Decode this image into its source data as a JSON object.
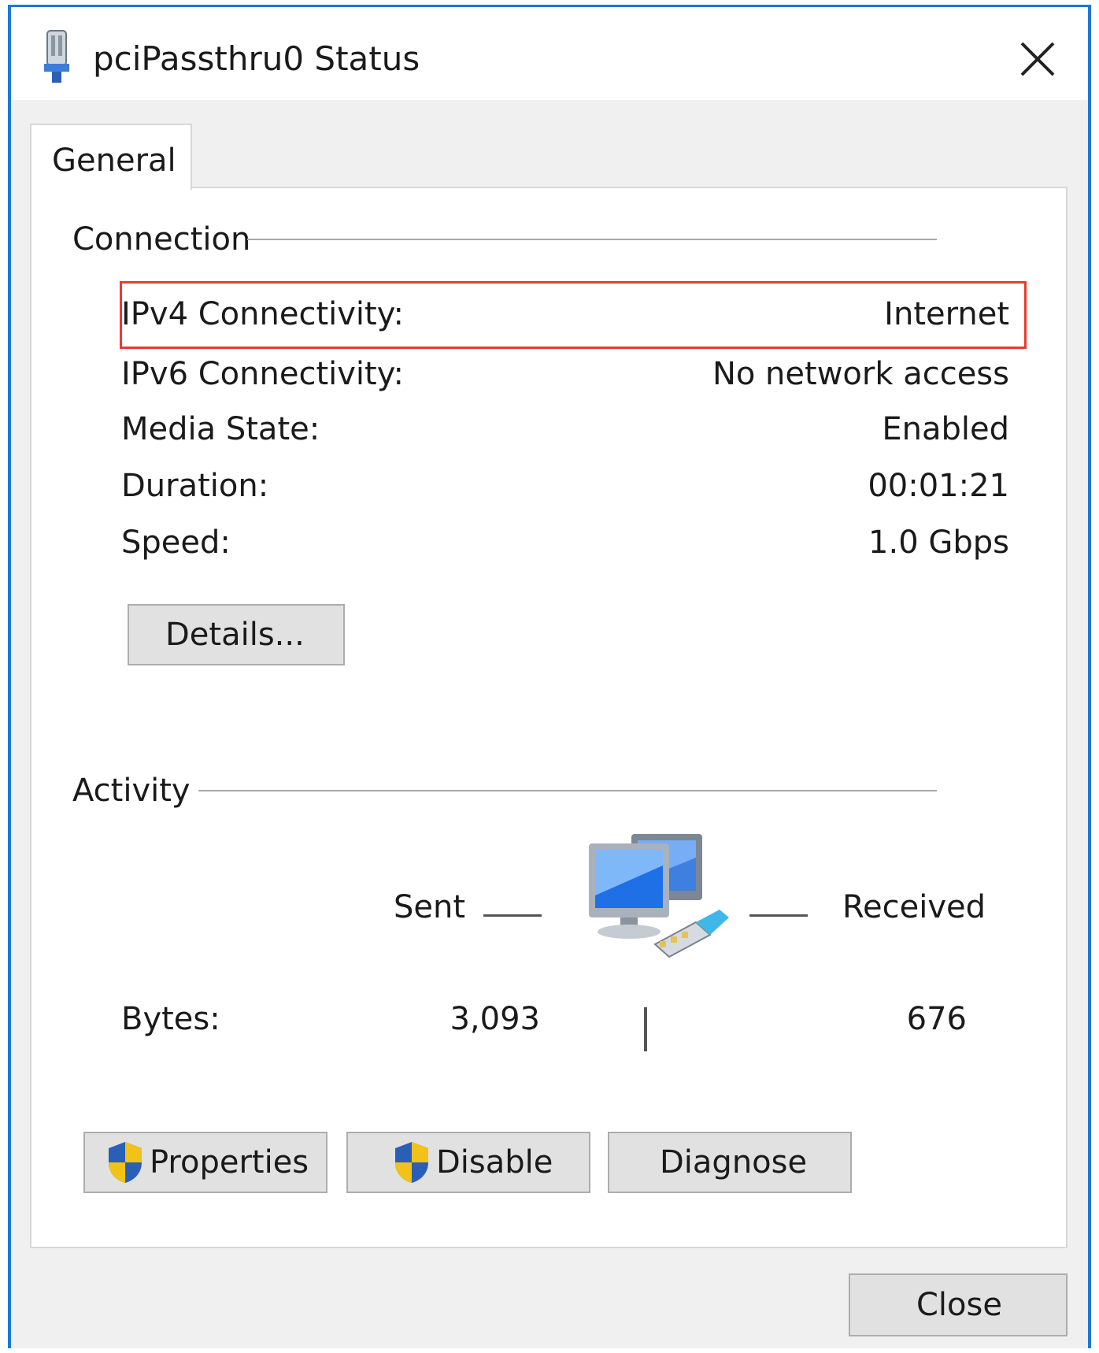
{
  "window": {
    "title": "pciPassthru0 Status",
    "close_glyph": "✕"
  },
  "tabs": [
    {
      "label": "General",
      "selected": true
    }
  ],
  "connection": {
    "group_title": "Connection",
    "rows": [
      {
        "label": "IPv4 Connectivity:",
        "value": "Internet",
        "highlighted": true
      },
      {
        "label": "IPv6 Connectivity:",
        "value": "No network access"
      },
      {
        "label": "Media State:",
        "value": "Enabled"
      },
      {
        "label": "Duration:",
        "value": "00:01:21"
      },
      {
        "label": "Speed:",
        "value": "1.0 Gbps"
      }
    ],
    "details_button": "Details..."
  },
  "activity": {
    "group_title": "Activity",
    "sent_label": "Sent",
    "received_label": "Received",
    "bytes_label": "Bytes:",
    "bytes_sent": "3,093",
    "bytes_received": "676",
    "icon": "network-computers-icon"
  },
  "buttons": {
    "properties": "Properties",
    "disable": "Disable",
    "diagnose": "Diagnose",
    "close": "Close"
  },
  "colors": {
    "window_border": "#1e78d4",
    "highlight_border": "#e83a2f",
    "shield_blue": "#2a5fb8",
    "shield_yellow": "#f2c218"
  }
}
